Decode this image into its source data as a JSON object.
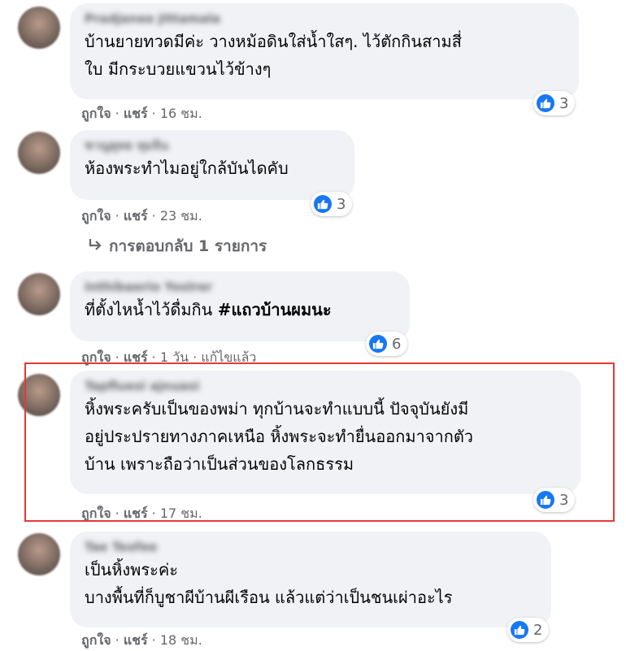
{
  "comments": [
    {
      "author": "Pradjanee Jittamala",
      "lines": [
        "บ้านยายทวดมีค่ะ วางหม้อดินใส่น้ำใสๆ. ไว้ตักกินสามสี่",
        "ใบ มีกระบวยแขวนไว้ข้างๆ"
      ],
      "reactions": "3",
      "like": "ถูกใจ",
      "share": "แชร์",
      "time": "16 ชม."
    },
    {
      "author": "ชาญยุทธ ทุมจิน",
      "lines": [
        "ห้องพระทำไมอยู่ใกล้บันไดคับ"
      ],
      "reactions": "3",
      "like": "ถูกใจ",
      "share": "แชร์",
      "time": "23 ชม.",
      "reply_link": "การตอบกลับ 1 รายการ"
    },
    {
      "author": "Inthibaerio Yoslrer",
      "line_plain": "ที่ตั้งไหน้ำไว้ดื่มกิน ",
      "line_tag": "#แถวบ้านผมนะ",
      "reactions": "6",
      "like": "ถูกใจ",
      "share": "แชร์",
      "time": "1 วัน",
      "edited": "แก้ไขแล้ว"
    },
    {
      "author": "Tapfluesi ajnuasi",
      "lines": [
        "หิ้งพระครับเป็นของพม่า ทุกบ้านจะทำแบบนี้ ปัจจุบันยังมี",
        "อยู่ประปรายทางภาคเหนือ หิ้งพระจะทำยื่นออกมาจากตัว",
        "บ้าน เพราะถือว่าเป็นส่วนของโลกธรรม"
      ],
      "reactions": "3",
      "like": "ถูกใจ",
      "share": "แชร์",
      "time": "17 ชม."
    },
    {
      "author": "Tae Teofee",
      "lines": [
        "เป็นหิ้งพระค่ะ",
        "บางพื้นที่ก็บูชาผีบ้านผีเรือน แล้วแต่ว่าเป็นชนเผ่าอะไร"
      ],
      "reactions": "2",
      "like": "ถูกใจ",
      "share": "แชร์",
      "time": "18 ชม."
    }
  ],
  "colors": {
    "bubble": "#f0f2f5",
    "like_blue": "#1877f2",
    "highlight": "#e53935",
    "meta_text": "#65676b"
  },
  "icons": [
    "like-icon",
    "reply-arrow-icon"
  ]
}
